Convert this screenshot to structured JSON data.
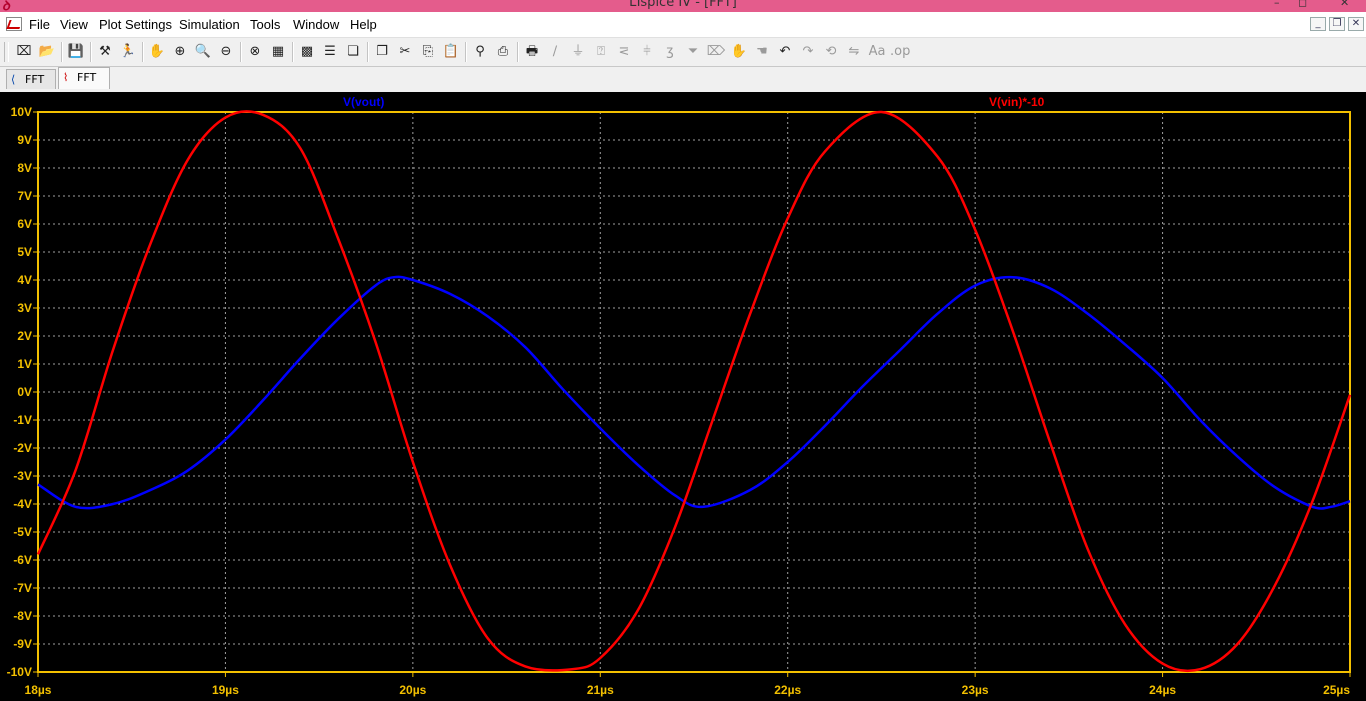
{
  "window": {
    "title": "LTspice IV - [FFT]",
    "app_icon": "ltspice-icon",
    "controls": [
      "–",
      "◻",
      "✕"
    ]
  },
  "menu": {
    "items": [
      {
        "label": "File",
        "underline": "F"
      },
      {
        "label": "View",
        "underline": "V"
      },
      {
        "label": "Plot Settings",
        "underline": "P"
      },
      {
        "label": "Simulation",
        "underline": "S"
      },
      {
        "label": "Tools",
        "underline": "T"
      },
      {
        "label": "Window",
        "underline": "W"
      },
      {
        "label": "Help",
        "underline": "H"
      }
    ],
    "mdi_controls": [
      "_",
      "❐",
      "✕"
    ]
  },
  "toolbar": {
    "buttons": [
      {
        "name": "new-schematic-icon",
        "glyph": "⌧",
        "enabled": true
      },
      {
        "name": "open-icon",
        "glyph": "📂",
        "enabled": true
      },
      {
        "name": "save-icon",
        "glyph": "💾",
        "enabled": true
      },
      {
        "name": "control-panel-icon",
        "glyph": "⚒",
        "enabled": true
      },
      {
        "name": "run-icon",
        "glyph": "🏃",
        "enabled": true
      },
      {
        "name": "halt-icon",
        "glyph": "✋",
        "enabled": false
      },
      {
        "name": "zoom-in-icon",
        "glyph": "⊕",
        "enabled": true
      },
      {
        "name": "zoom-pan-icon",
        "glyph": "🔍",
        "enabled": true
      },
      {
        "name": "zoom-out-icon",
        "glyph": "⊖",
        "enabled": true
      },
      {
        "name": "zoom-fit-icon",
        "glyph": "⊗",
        "enabled": true
      },
      {
        "name": "autorange-icon",
        "glyph": "▦",
        "enabled": true
      },
      {
        "name": "view-fft-icon",
        "glyph": "▩",
        "enabled": true
      },
      {
        "name": "tile-horizontal-icon",
        "glyph": "☰",
        "enabled": true
      },
      {
        "name": "cascade-icon",
        "glyph": "❏",
        "enabled": true
      },
      {
        "name": "close-all-icon",
        "glyph": "❐",
        "enabled": true
      },
      {
        "name": "cut-icon",
        "glyph": "✂",
        "enabled": true
      },
      {
        "name": "copy-icon",
        "glyph": "⎘",
        "enabled": true
      },
      {
        "name": "paste-icon",
        "glyph": "📋",
        "enabled": true
      },
      {
        "name": "find-icon",
        "glyph": "⚲",
        "enabled": true
      },
      {
        "name": "print-setup-icon",
        "glyph": "⎙",
        "enabled": true
      },
      {
        "name": "print-icon",
        "glyph": "🖶",
        "enabled": true
      },
      {
        "name": "wire-icon",
        "glyph": "∕",
        "enabled": false
      },
      {
        "name": "ground-icon",
        "glyph": "⏚",
        "enabled": false
      },
      {
        "name": "label-net-icon",
        "glyph": "⍰",
        "enabled": false
      },
      {
        "name": "resistor-icon",
        "glyph": "⋜",
        "enabled": false
      },
      {
        "name": "capacitor-icon",
        "glyph": "⫩",
        "enabled": false
      },
      {
        "name": "inductor-icon",
        "glyph": "ʒ",
        "enabled": false
      },
      {
        "name": "diode-icon",
        "glyph": "⏷",
        "enabled": false
      },
      {
        "name": "component-icon",
        "glyph": "⌦",
        "enabled": false
      },
      {
        "name": "move-icon",
        "glyph": "✋",
        "enabled": false
      },
      {
        "name": "drag-icon",
        "glyph": "☚",
        "enabled": false
      },
      {
        "name": "undo-icon",
        "glyph": "↶",
        "enabled": true
      },
      {
        "name": "redo-icon",
        "glyph": "↷",
        "enabled": false
      },
      {
        "name": "rotate-icon",
        "glyph": "⟲",
        "enabled": false
      },
      {
        "name": "mirror-icon",
        "glyph": "⇋",
        "enabled": false
      },
      {
        "name": "text-icon",
        "glyph": "Aa",
        "enabled": false
      },
      {
        "name": "spice-directive-icon",
        "glyph": ".op",
        "enabled": false
      }
    ]
  },
  "tabs": [
    {
      "label": "FFT",
      "icon": "schematic-icon",
      "active": false
    },
    {
      "label": "FFT",
      "icon": "waveform-icon",
      "active": true
    }
  ],
  "colors": {
    "background": "#000000",
    "grid": "#a0a0a0",
    "frame": "#f3c000",
    "trace_vout": "#0000ff",
    "trace_vin": "#ff0000"
  },
  "chart_data": {
    "type": "line",
    "title": "",
    "xlabel": "",
    "ylabel": "",
    "xlim": [
      18,
      25
    ],
    "ylim": [
      -10,
      10
    ],
    "grid": true,
    "x_ticks": [
      "18µs",
      "19µs",
      "20µs",
      "21µs",
      "22µs",
      "23µs",
      "24µs",
      "25µs"
    ],
    "y_ticks": [
      "10V",
      "9V",
      "8V",
      "7V",
      "6V",
      "5V",
      "4V",
      "3V",
      "2V",
      "1V",
      "0V",
      "-1V",
      "-2V",
      "-3V",
      "-4V",
      "-5V",
      "-6V",
      "-7V",
      "-8V",
      "-9V",
      "-10V"
    ],
    "series": [
      {
        "name": "V(vout)",
        "color": "#0000ff",
        "x": [
          18.0,
          18.2,
          18.4,
          18.6,
          18.8,
          19.0,
          19.2,
          19.4,
          19.6,
          19.8,
          19.9,
          20.0,
          20.2,
          20.4,
          20.6,
          20.8,
          21.0,
          21.2,
          21.4,
          21.55,
          21.8,
          22.0,
          22.2,
          22.4,
          22.6,
          22.8,
          23.0,
          23.2,
          23.4,
          23.6,
          23.8,
          24.0,
          24.2,
          24.4,
          24.6,
          24.8,
          24.9,
          25.0
        ],
        "y": [
          -3.3,
          -4.1,
          -4.0,
          -3.5,
          -2.8,
          -1.7,
          -0.3,
          1.2,
          2.6,
          3.8,
          4.1,
          4.0,
          3.5,
          2.7,
          1.6,
          0.1,
          -1.3,
          -2.6,
          -3.7,
          -4.1,
          -3.5,
          -2.5,
          -1.2,
          0.2,
          1.5,
          2.8,
          3.8,
          4.1,
          3.7,
          2.8,
          1.7,
          0.5,
          -1.0,
          -2.3,
          -3.4,
          -4.1,
          -4.1,
          -3.9
        ]
      },
      {
        "name": "V(vin)*-10",
        "color": "#ff0000",
        "x": [
          18.0,
          18.2,
          18.4,
          18.6,
          18.8,
          19.0,
          19.2,
          19.4,
          19.6,
          19.8,
          20.0,
          20.2,
          20.4,
          20.6,
          20.85,
          21.0,
          21.2,
          21.4,
          21.6,
          21.8,
          22.0,
          22.2,
          22.5,
          22.8,
          23.0,
          23.2,
          23.4,
          23.6,
          23.8,
          24.0,
          24.2,
          24.4,
          24.6,
          24.8,
          25.0
        ],
        "y": [
          -5.8,
          -2.8,
          1.5,
          5.3,
          8.3,
          9.8,
          9.9,
          8.7,
          5.5,
          1.8,
          -2.5,
          -6.2,
          -8.8,
          -9.8,
          -9.9,
          -9.5,
          -7.8,
          -4.8,
          -1.0,
          2.8,
          6.2,
          8.6,
          10.0,
          8.4,
          5.8,
          2.2,
          -1.8,
          -5.6,
          -8.3,
          -9.7,
          -9.9,
          -9.0,
          -6.9,
          -3.9,
          -0.1
        ]
      }
    ]
  }
}
